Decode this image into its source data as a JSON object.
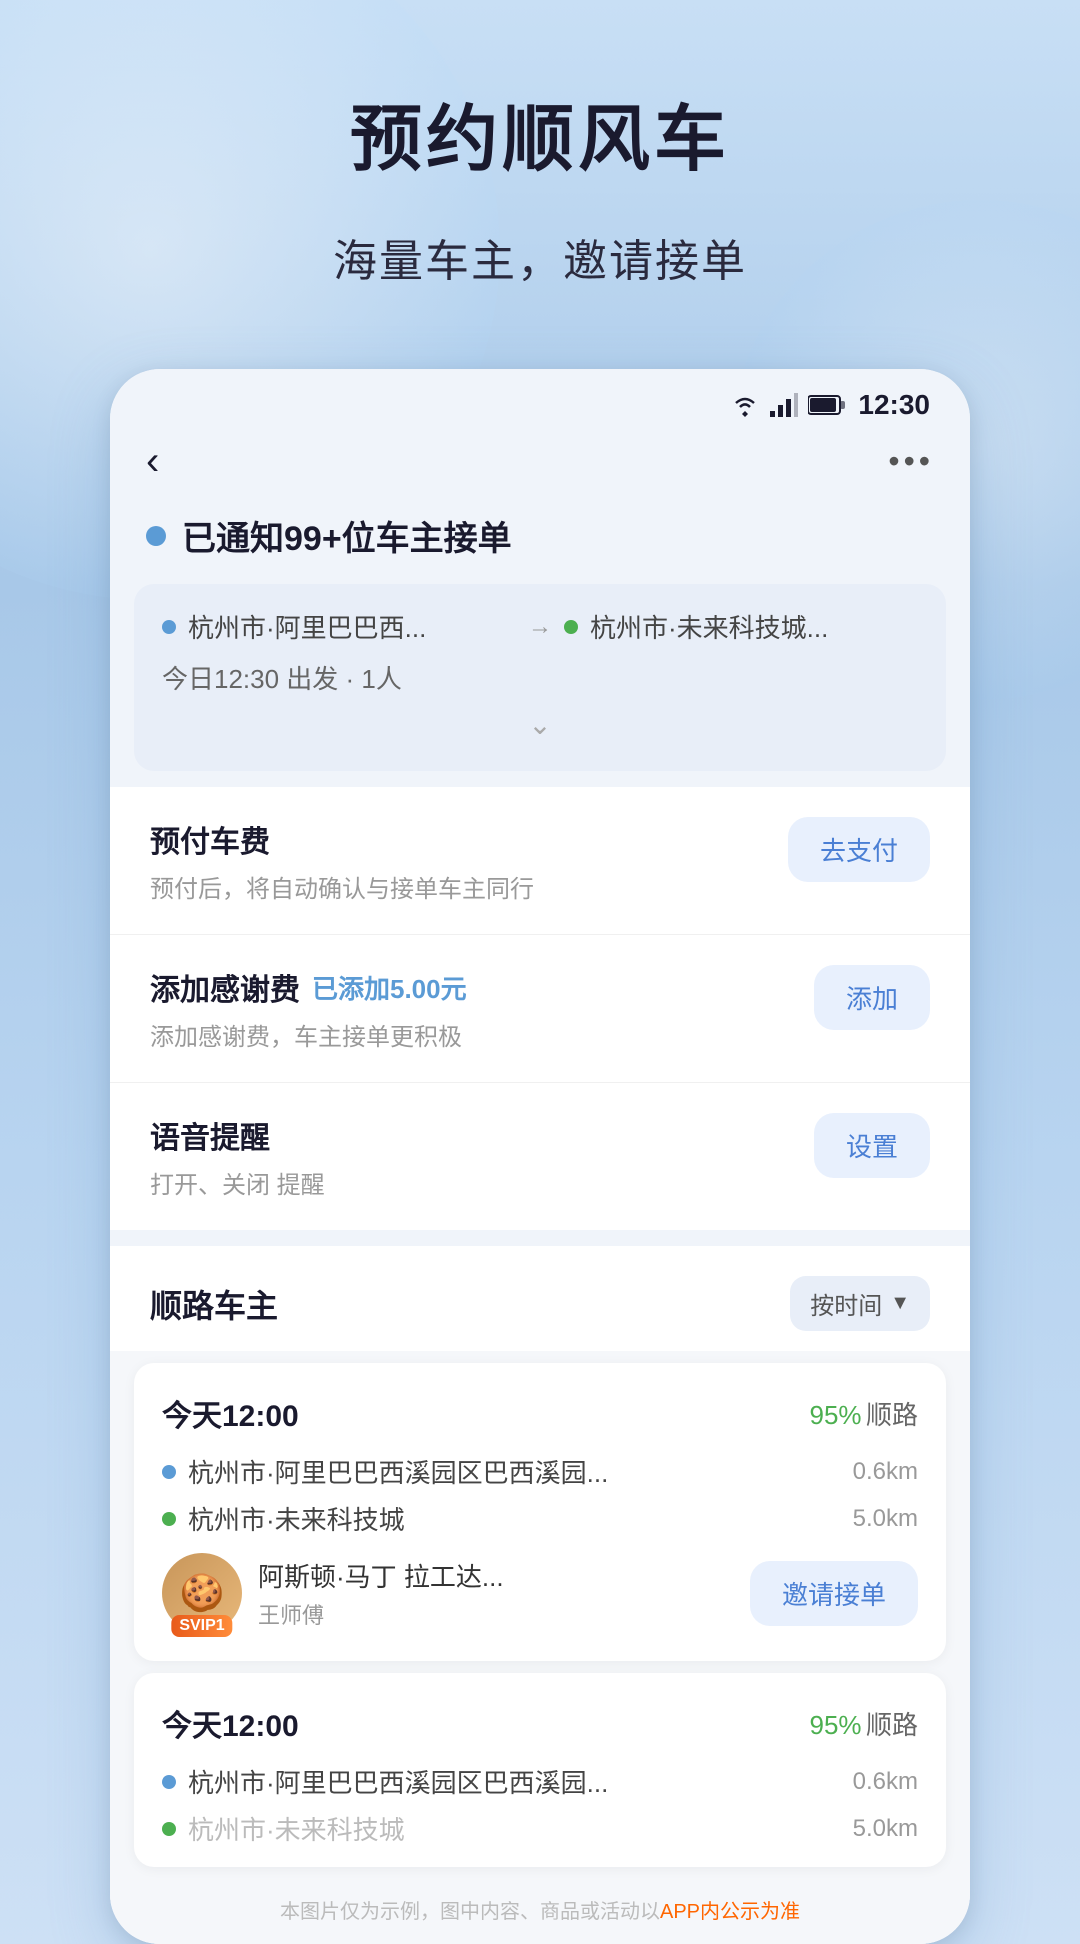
{
  "page": {
    "title": "预约顺风车",
    "subtitle": "海量车主，邀请接单"
  },
  "status_bar": {
    "time": "12:30",
    "wifi_icon": "▼",
    "signal_icon": "▲",
    "battery_icon": "▮"
  },
  "nav": {
    "back_icon": "‹",
    "more_icon": "•••"
  },
  "notification": {
    "text": "已通知99+位车主接单"
  },
  "route": {
    "from": "杭州市·阿里巴巴西...",
    "to": "杭州市·未来科技城...",
    "departure_info": "今日12:30 出发 · 1人"
  },
  "actions": [
    {
      "id": "prepay",
      "title": "预付车费",
      "subtitle": "预付后，将自动确认与接单车主同行",
      "btn_label": "去支付",
      "added_text": ""
    },
    {
      "id": "tip",
      "title": "添加感谢费",
      "added_text": "已添加5.00元",
      "subtitle": "添加感谢费，车主接单更积极",
      "btn_label": "添加"
    },
    {
      "id": "voice",
      "title": "语音提醒",
      "subtitle": "打开、关闭 提醒",
      "btn_label": "设置",
      "added_text": ""
    }
  ],
  "drivers_section": {
    "title": "顺路车主",
    "sort_label": "按时间",
    "sort_icon": "▼"
  },
  "drivers": [
    {
      "time": "今天12:00",
      "route_pct": "95%",
      "route_label": "顺路",
      "from": "杭州市·阿里巴巴西溪园区巴西溪园...",
      "from_distance": "0.6km",
      "to": "杭州市·未来科技城",
      "to_distance": "5.0km",
      "driver_name": "阿斯顿·马丁 拉工达...",
      "driver_role": "王师傅",
      "svip_label": "SVIP1",
      "invite_label": "邀请接单",
      "avatar_emoji": "🍪"
    },
    {
      "time": "今天12:00",
      "route_pct": "95%",
      "route_label": "顺路",
      "from": "杭州市·阿里巴巴西溪园区巴西溪园...",
      "from_distance": "0.6km",
      "to": "杭州市·未来科技城",
      "to_distance": "5.0km",
      "driver_name": "",
      "driver_role": "",
      "svip_label": "",
      "invite_label": "",
      "avatar_emoji": ""
    }
  ],
  "footer": {
    "disclaimer": "本图片仅为示例，图中内容、商品或活动以APP内公示为准"
  },
  "colors": {
    "blue": "#4a7fd4",
    "green": "#4caf50",
    "orange": "#ff6600",
    "dot_blue": "#5b9bd5",
    "dot_green": "#4caf50",
    "bg_gradient_start": "#c8dff5",
    "bg_gradient_end": "#a8c8e8"
  }
}
